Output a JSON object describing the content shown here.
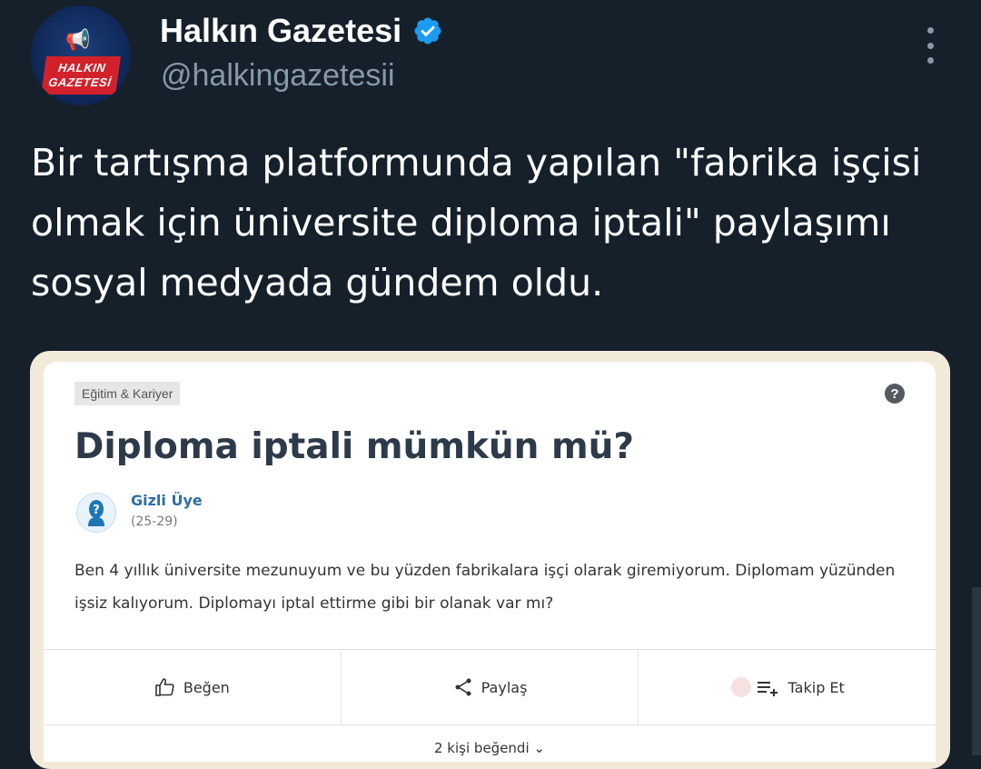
{
  "account": {
    "display_name": "Halkın Gazetesi",
    "handle": "@halkingazetesii",
    "logo_text": [
      "HALKIN",
      "GAZETESİ"
    ],
    "verified": true
  },
  "tweet": {
    "text": "Bir tartışma platformunda yapılan \"fabrika işçisi olmak için üniversite diploma iptali\" paylaşımı sosyal medyada gündem oldu."
  },
  "card": {
    "category": "Eğitim & Kariyer",
    "question_title": "Diploma iptali mümkün mü?",
    "user_name": "Gizli Üye",
    "user_age": "(25-29)",
    "body": "Ben 4 yıllık üniversite mezunuyum ve bu yüzden fabrikalara işçi olarak giremiyorum. Diplomam yüzünden işsiz kalıyorum. Diplomayı iptal ettirme gibi bir olanak var mı?",
    "actions": {
      "like": "Beğen",
      "share": "Paylaş",
      "follow": "Takip Et"
    },
    "likes_text": "2 kişi beğendi"
  },
  "colors": {
    "background": "#15202b",
    "verified": "#1d9bf0",
    "logo_red": "#d3212b",
    "card_frame": "#f2ead9",
    "user_link": "#2e6fa3"
  },
  "icons": {
    "verified": "verified-badge-icon",
    "more": "more-vertical-icon",
    "help": "question-circle-icon",
    "like": "thumbs-up-icon",
    "share": "share-icon",
    "follow": "follow-list-icon"
  }
}
